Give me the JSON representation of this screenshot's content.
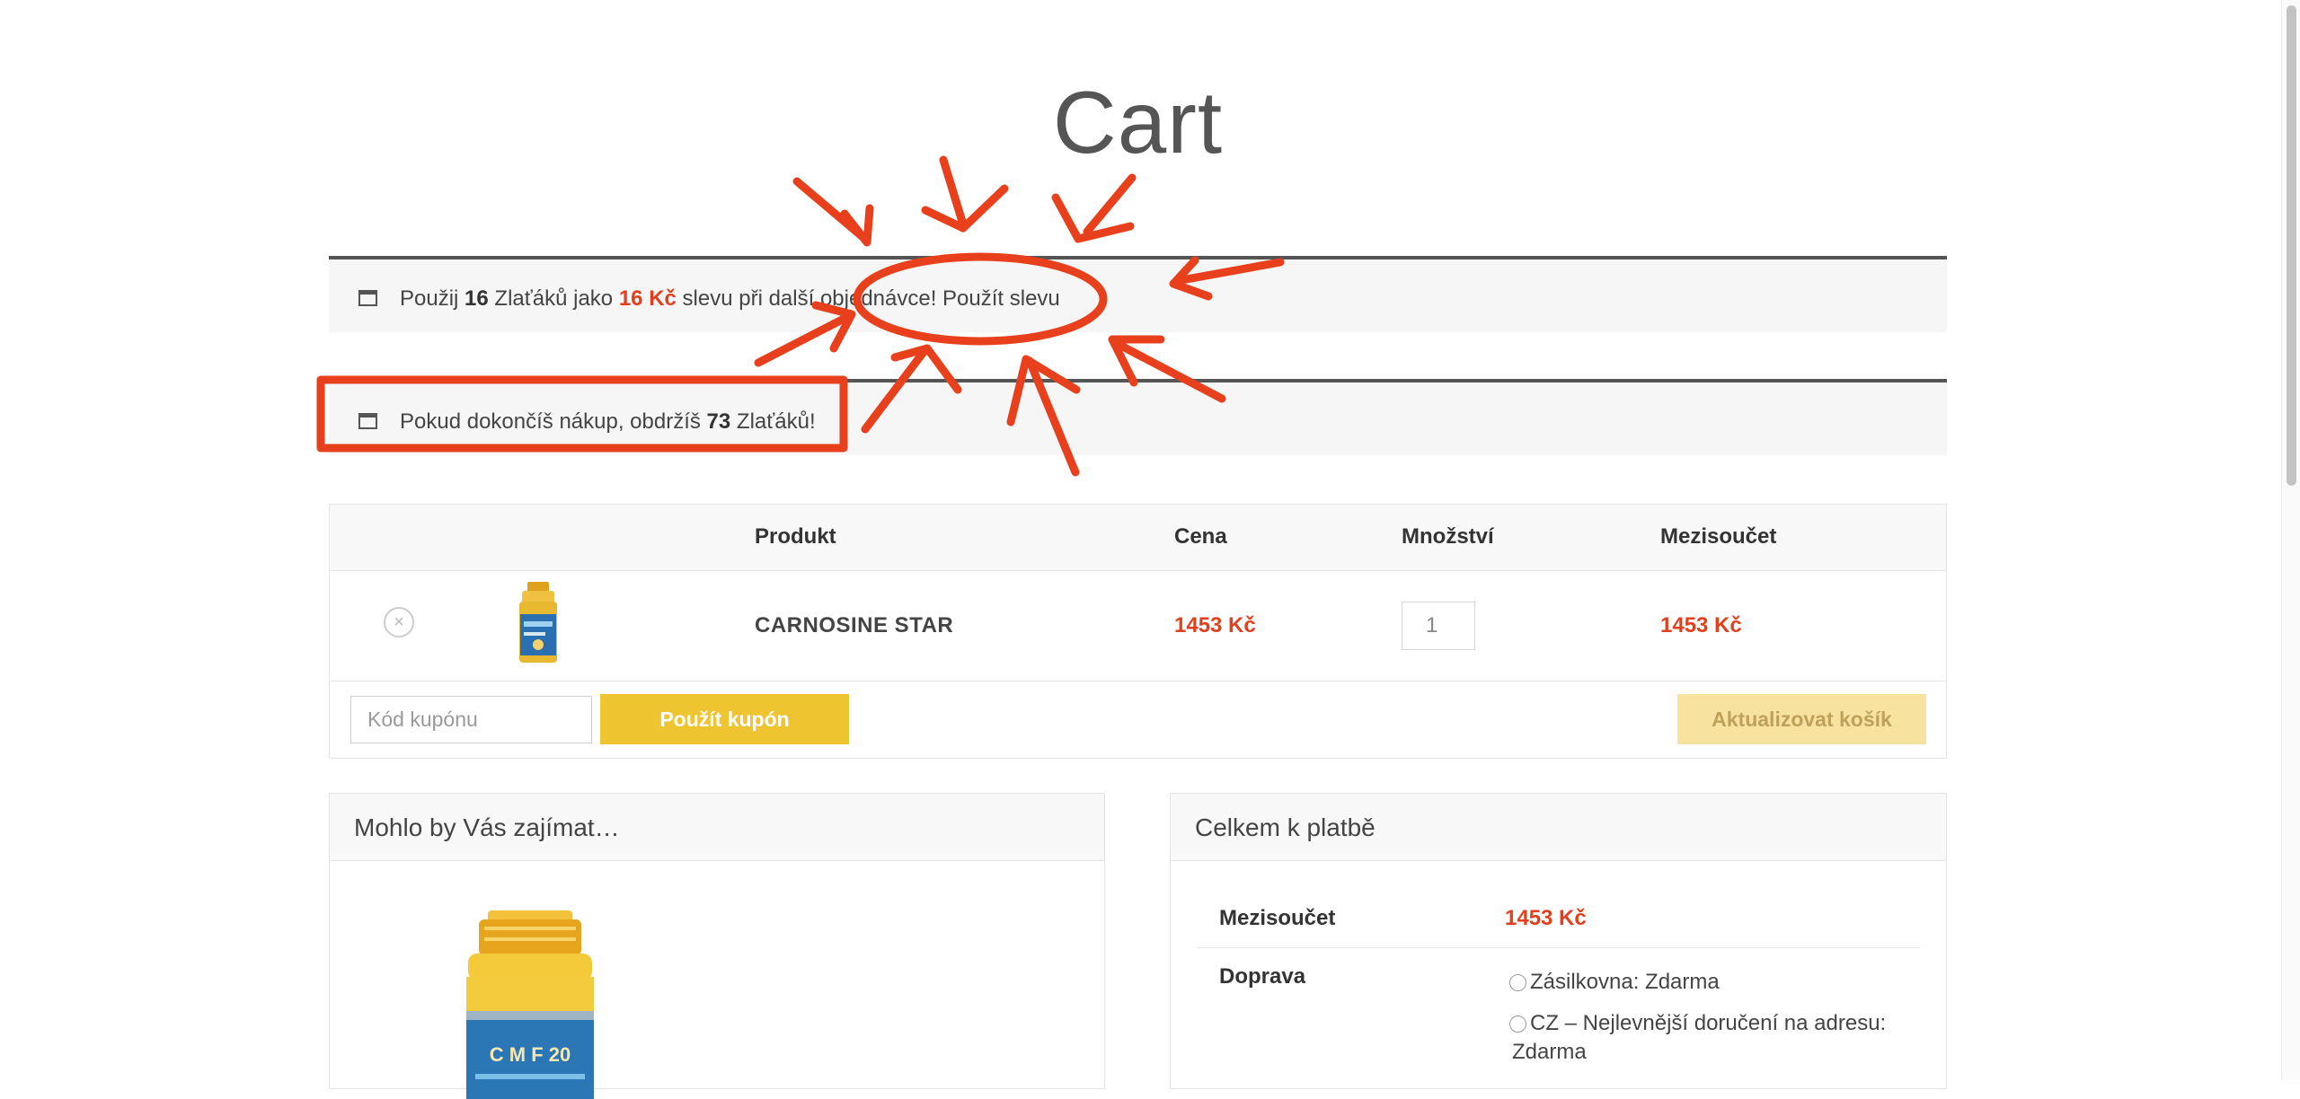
{
  "page": {
    "title": "Cart"
  },
  "notice_discount": {
    "p1": "Použij ",
    "points": "16",
    "p2": " Zlaťáků jako ",
    "amount": "16 Kč",
    "p3": " slevu při další objednávce! ",
    "link": "Použít slevu"
  },
  "notice_reward": {
    "p1": "Pokud dokončíš nákup, obdržíš ",
    "points": "73",
    "p2": " Zlaťáků!"
  },
  "cart": {
    "columns": {
      "product": "Produkt",
      "price": "Cena",
      "quantity": "Množství",
      "subtotal": "Mezisoučet"
    },
    "items": [
      {
        "name": "CARNOSINE STAR",
        "price": "1453 Kč",
        "quantity": "1",
        "subtotal": "1453 Kč"
      }
    ],
    "coupon_placeholder": "Kód kupónu",
    "apply_coupon": "Použít kupón",
    "update_cart": "Aktualizovat košík"
  },
  "cross_sells": {
    "title": "Mohlo by Vás zajímat…"
  },
  "totals": {
    "title": "Celkem k platbě",
    "subtotal_label": "Mezisoučet",
    "subtotal_value": "1453 Kč",
    "shipping_label": "Doprava",
    "shipping_options": [
      {
        "label": "Zásilkovna: Zdarma"
      },
      {
        "label": "CZ – Nejlevnější doručení na adresu:",
        "label_cont": "Zdarma"
      }
    ]
  },
  "colors": {
    "accent": "#e2401c",
    "button": "#eec430",
    "button_disabled": "#f8e2a0",
    "annotation": "#e8401c"
  },
  "icons": [
    "calendar-icon",
    "remove-icon",
    "radio-icon"
  ]
}
